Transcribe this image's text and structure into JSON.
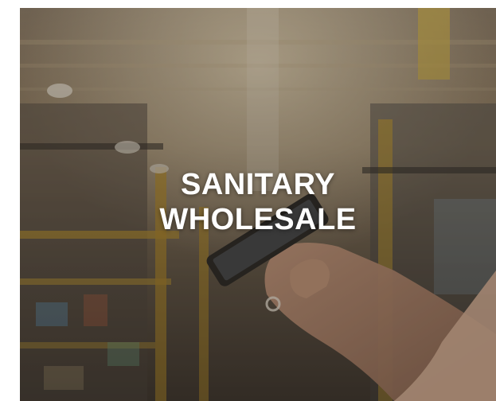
{
  "banner": {
    "title_line1": "SANITARY",
    "title_line2": "WHOLESALE",
    "background": "warehouse-photo-hand-holding-phone",
    "overlay_color": "#3a3128",
    "text_color": "#ffffff"
  }
}
